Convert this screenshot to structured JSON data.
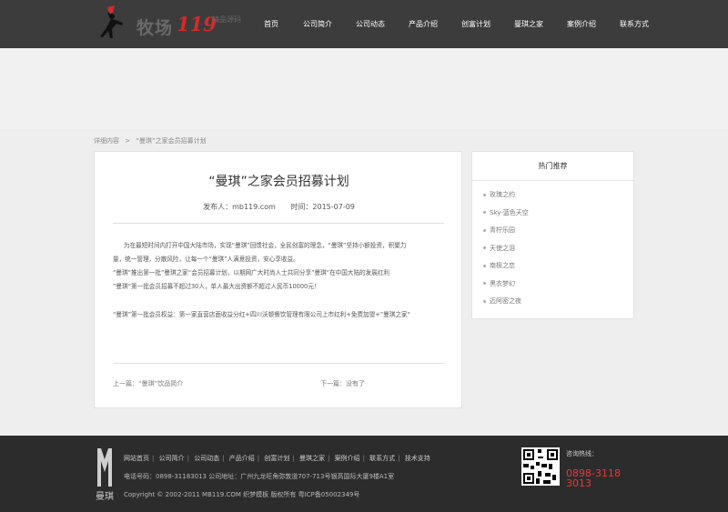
{
  "header": {
    "logo_text": "牧场",
    "logo_number": "119",
    "logo_slogan": "精品源码",
    "nav": [
      "首页",
      "公司简介",
      "公司动态",
      "产品介绍",
      "创富计划",
      "曼琪之家",
      "案例介绍",
      "联系方式"
    ]
  },
  "breadcrumb": {
    "root": "详细内容",
    "separator": ">",
    "current": "“曼琪”之家会员招募计划"
  },
  "article": {
    "title": "“曼琪”之家会员招募计划",
    "author": "发布人：mb119.com",
    "date": "时间：2015-07-09",
    "paragraphs": [
      "为在最短时间内打开中国大陆市场，实现“曼琪”回馈社会，全民创富的理念，“曼琪”坚持小额投资，积聚力",
      "量，统一管理，分散风险，让每一个“曼琪”人满意投资，安心享收益。",
      "“曼琪“推出第一批”曼琪之家“会员招募计划，以期网广大时尚人士共同分享”曼琪“在中国大陆的发展红利",
      "”曼琪“第一批会员招募不超过30人，单人最大出资额不超过人民币10000元！",
      "“曼琪”第一批会员权益：第一家直营店面收益分红+四川沃顿餐饮管理有限公司上市红利+免费加盟+”曼琪之家“"
    ],
    "prev": "上一篇：“曼琪”饮品简介",
    "next": "下一篇：没有了"
  },
  "sidebar": {
    "title": "热门推荐",
    "items": [
      "玫瑰之约",
      "Sky-蓝色天空",
      "青柠乐园",
      "天使之泪",
      "南极之恋",
      "黑衣梦幻",
      "迈阿密之夜"
    ]
  },
  "footer": {
    "logo_text": "曼琪",
    "links": [
      "网站首页",
      "公司简介",
      "公司动态",
      "产品介绍",
      "创富计划",
      "曼琪之家",
      "案例介绍",
      "联系方式",
      "技术支持"
    ],
    "contact": "电话号码：0898-31183013 公司地址：广州九龙旺角弥敦道707-713号银高国际大厦9楼A1室",
    "copyright": "Copyright © 2002-2011 MB119.COM 织梦模板 版权所有 粤ICP备05002349号",
    "hotline_label": "咨询热线：",
    "hotline_number": "0898-31183013"
  },
  "colors": {
    "header_bg": "#3c3c3c",
    "footer_bg": "#2c2c2c",
    "accent_red": "#e63b3b",
    "page_bg": "#eeeeee"
  }
}
